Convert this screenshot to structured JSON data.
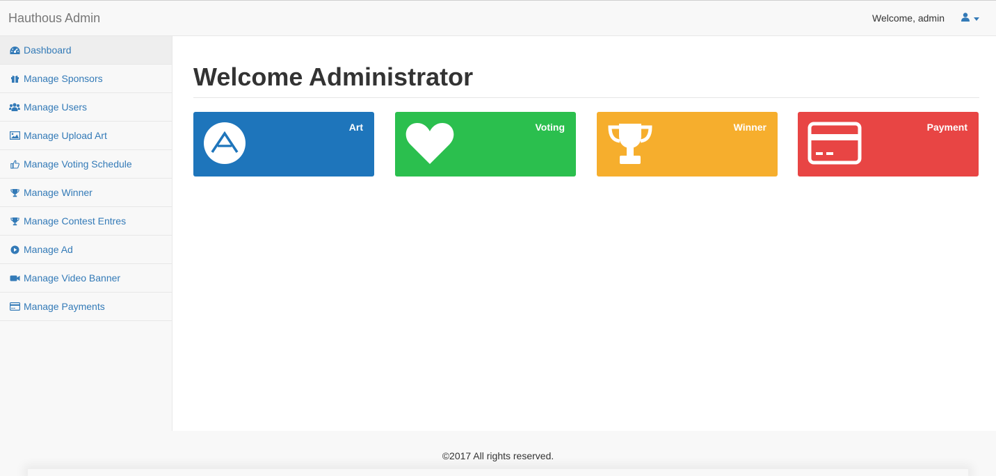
{
  "navbar": {
    "brand": "Hauthous Admin",
    "welcome": "Welcome, admin",
    "user_icon": "user-icon"
  },
  "sidebar": {
    "items": [
      {
        "label": "Dashboard",
        "icon": "dashboard-icon",
        "active": true
      },
      {
        "label": "Manage Sponsors",
        "icon": "gift-icon"
      },
      {
        "label": "Manage Users",
        "icon": "users-icon"
      },
      {
        "label": "Manage Upload Art",
        "icon": "picture-icon"
      },
      {
        "label": "Manage Voting Schedule",
        "icon": "thumbs-up-icon"
      },
      {
        "label": "Manage Winner",
        "icon": "trophy-icon"
      },
      {
        "label": "Manage Contest Entres",
        "icon": "trophy-icon"
      },
      {
        "label": "Manage Ad",
        "icon": "play-circle-icon"
      },
      {
        "label": "Manage Video Banner",
        "icon": "video-camera-icon"
      },
      {
        "label": "Manage Payments",
        "icon": "credit-card-icon"
      }
    ]
  },
  "main": {
    "title": "Welcome Administrator",
    "tiles": [
      {
        "label": "Art",
        "icon": "art-logo-icon",
        "color": "#1e75bb"
      },
      {
        "label": "Voting",
        "icon": "heart-icon",
        "color": "#2bbf4e"
      },
      {
        "label": "Winner",
        "icon": "trophy-icon",
        "color": "#f6ae2d"
      },
      {
        "label": "Payment",
        "icon": "credit-card-icon",
        "color": "#e84544"
      }
    ]
  },
  "footer": {
    "text": "©2017 All rights reserved."
  },
  "colors": {
    "link": "#337ab7",
    "navbar_bg": "#f8f8f8"
  }
}
